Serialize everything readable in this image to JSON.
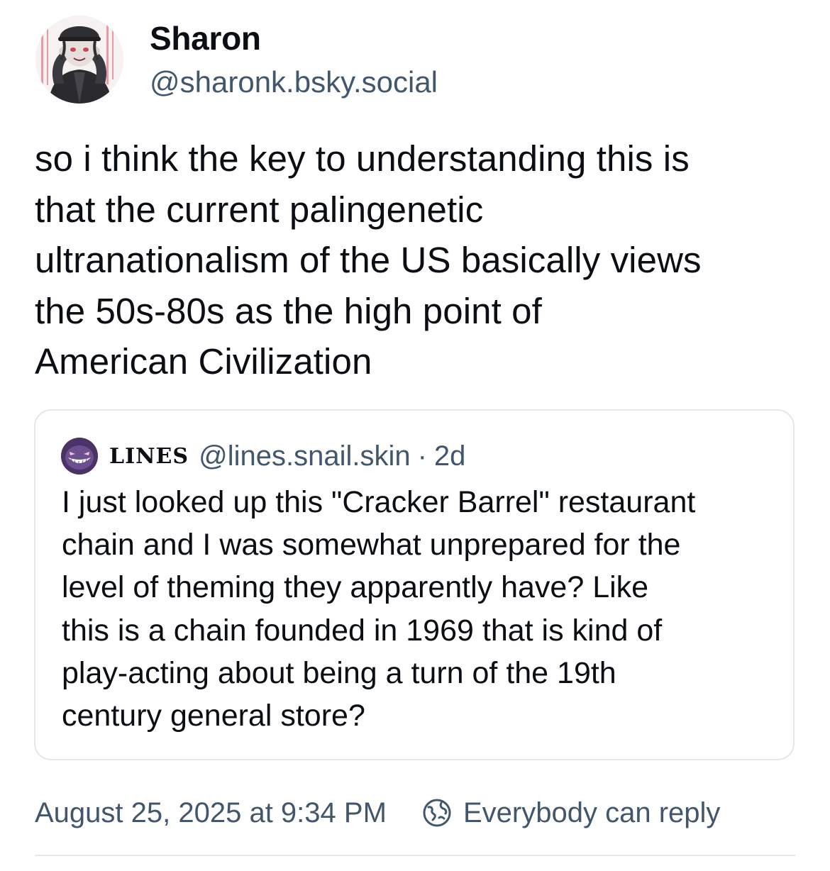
{
  "author": {
    "display_name": "Sharon",
    "handle": "@sharonk.bsky.social",
    "avatar_icon": "anime-avatar-icon"
  },
  "post": {
    "text": "so i think the key to understanding this is\nthat the  current palingenetic\nultranationalism of the US basically views\nthe 50s-80s as the high point of\nAmerican Civilization"
  },
  "quoted_post": {
    "display_name": "LINES",
    "handle": "@lines.snail.skin",
    "separator": "·",
    "time_ago": "2d",
    "avatar_icon": "grinning-ghost-avatar-icon",
    "text": "I just looked up this \"Cracker Barrel\" restaurant\nchain and I was somewhat unprepared for the\nlevel of theming they apparently have? Like\nthis is a chain founded in 1969 that is kind of\nplay-acting about being a turn of the 19th\ncentury general store?"
  },
  "footer": {
    "timestamp": "August 25, 2025 at 9:34 PM",
    "reply_setting": "Everybody can reply",
    "reply_icon": "earth-globe-icon"
  },
  "colors": {
    "text_primary": "#0b0f14",
    "text_secondary": "#42576c",
    "border": "#e4e8ec",
    "background": "#ffffff"
  }
}
